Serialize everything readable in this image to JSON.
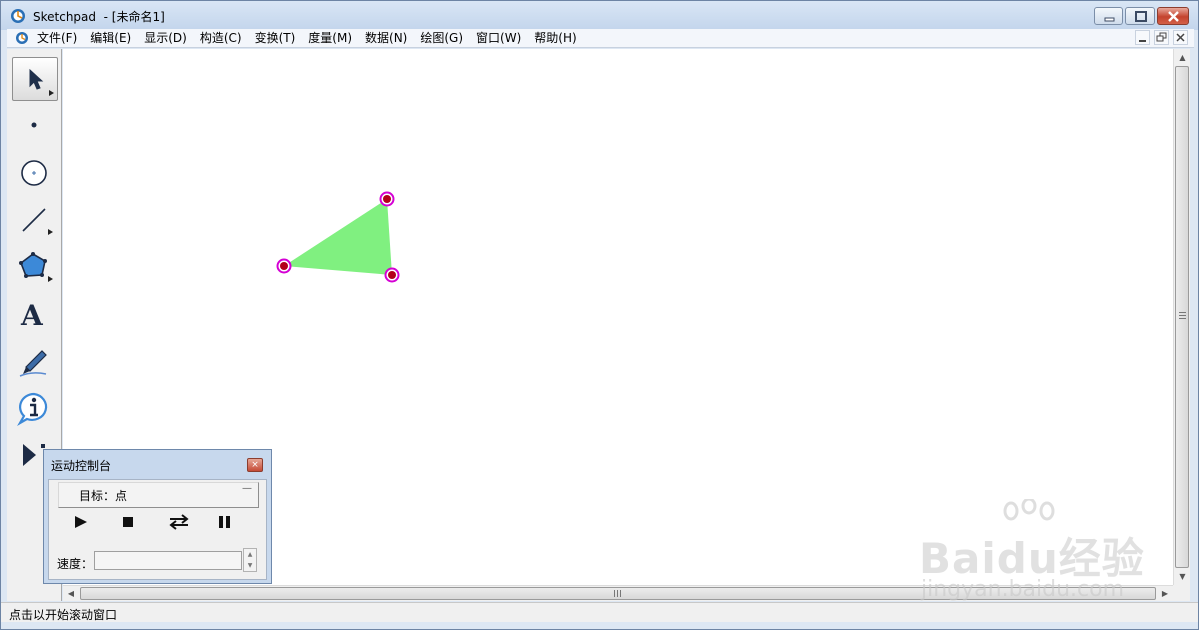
{
  "window": {
    "title": "Sketchpad  - [未命名1]"
  },
  "menu": {
    "items": [
      "文件(F)",
      "编辑(E)",
      "显示(D)",
      "构造(C)",
      "变换(T)",
      "度量(M)",
      "数据(N)",
      "绘图(G)",
      "窗口(W)",
      "帮助(H)"
    ]
  },
  "toolbox": {
    "tools": [
      "arrow-select-tool",
      "point-tool",
      "compass-tool",
      "straightedge-tool",
      "polygon-tool",
      "text-tool",
      "marker-tool",
      "information-tool",
      "custom-tool"
    ],
    "text_tool_glyph": "A"
  },
  "canvas": {
    "polygon_fill": "#80f080",
    "point_fill": "#b3001b",
    "point_ring": "#d400d4"
  },
  "motion_controller": {
    "title": "运动控制台",
    "target_label": "目标：点",
    "speed_label": "速度：",
    "close_glyph": "×"
  },
  "status": {
    "text": "点击以开始滚动窗口"
  },
  "watermark": {
    "brand": "Baidu经验",
    "url": "jingyan.baidu.com"
  },
  "colors": {
    "titlebar": "#c9d9ee",
    "close_button": "#c4432e"
  }
}
